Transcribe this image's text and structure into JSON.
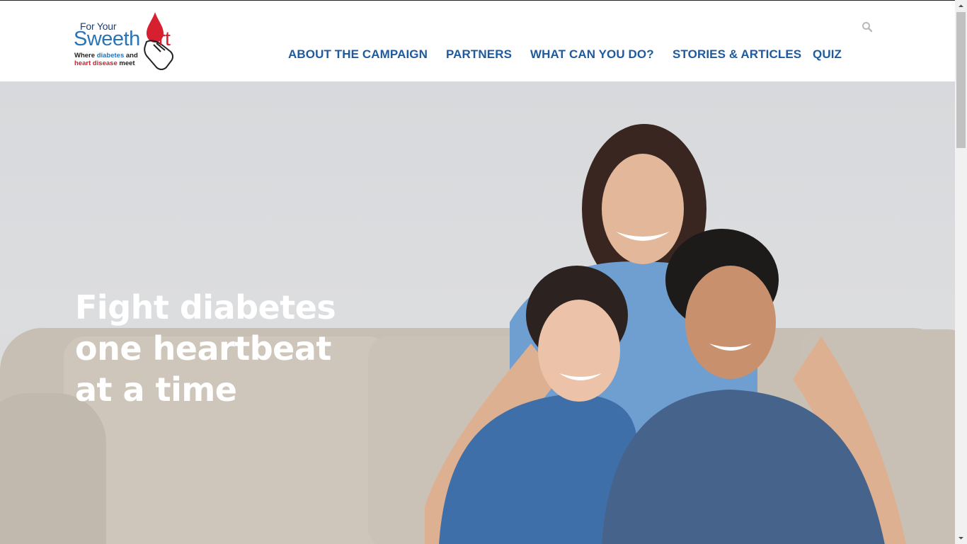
{
  "logo": {
    "top_text": "For Your",
    "main_left": "Sweeth",
    "main_right": "rt",
    "tagline_line1_a": "Where ",
    "tagline_line1_b": "diabetes",
    "tagline_line1_c": " and",
    "tagline_line2_a": "heart disease",
    "tagline_line2_b": " meet"
  },
  "nav": {
    "items": [
      {
        "label": "ABOUT THE CAMPAIGN"
      },
      {
        "label": "PARTNERS"
      },
      {
        "label": "WHAT CAN YOU DO?"
      },
      {
        "label": "STORIES & ARTICLES"
      },
      {
        "label": "QUIZ"
      }
    ]
  },
  "hero": {
    "headline_line1": "Fight diabetes",
    "headline_line2": "one heartbeat",
    "headline_line3": "at a time"
  },
  "colors": {
    "nav_text": "#1f5a9e",
    "brand_blue": "#2a74b8",
    "brand_red": "#d6202f"
  },
  "icons": [
    "search-icon",
    "heart-drop-icon",
    "scroll-up-arrow",
    "scroll-down-arrow"
  ]
}
